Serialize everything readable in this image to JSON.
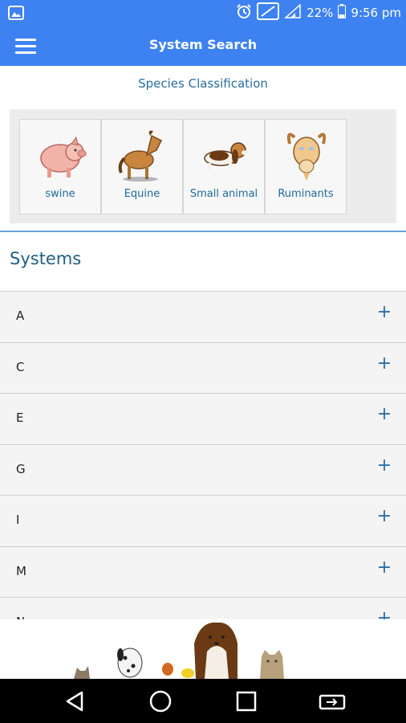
{
  "status_bar": {
    "battery_percent": "22%",
    "time": "9:56 pm"
  },
  "app_bar": {
    "title": "System Search"
  },
  "species": {
    "caption": "Species Classification",
    "items": [
      {
        "label": "swine",
        "icon": "pig-icon"
      },
      {
        "label": "Equine",
        "icon": "horse-icon"
      },
      {
        "label": "Small animal",
        "icon": "dog-icon"
      },
      {
        "label": "Ruminants",
        "icon": "goat-icon"
      }
    ]
  },
  "systems": {
    "title": "Systems",
    "rows": [
      {
        "letter": "A",
        "action": "+"
      },
      {
        "letter": "C",
        "action": "+"
      },
      {
        "letter": "E",
        "action": "+"
      },
      {
        "letter": "G",
        "action": "+"
      },
      {
        "letter": "I",
        "action": "+"
      },
      {
        "letter": "M",
        "action": "+"
      },
      {
        "letter": "N",
        "action": "+"
      }
    ]
  },
  "colors": {
    "app_bar": "#3d82f0",
    "accent_text": "#1f5f86",
    "plus": "#2b6fa8"
  }
}
